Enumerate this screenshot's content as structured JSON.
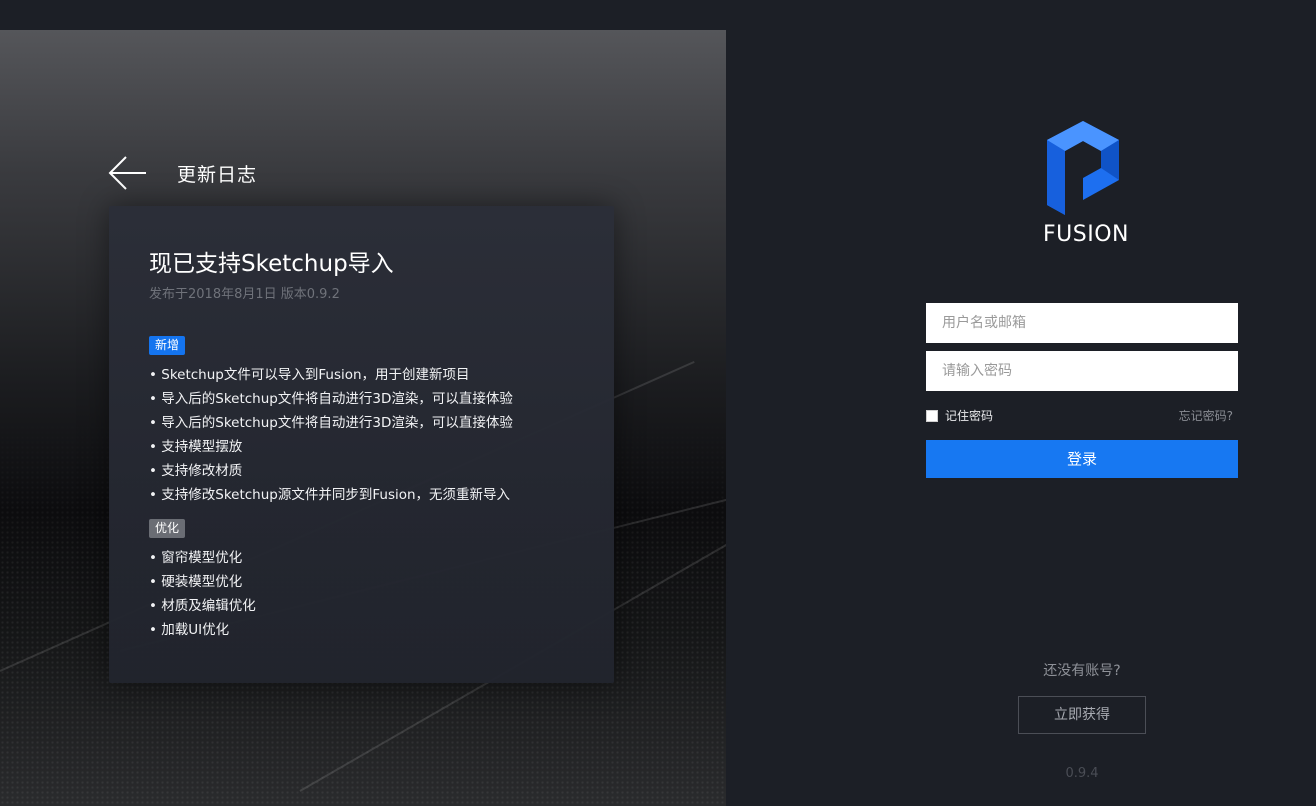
{
  "changelog": {
    "back_title": "更新日志",
    "heading": "现已支持Sketchup导入",
    "date_version": "发布于2018年8月1日 版本0.9.2",
    "new_badge": "新增",
    "new_items": [
      "• Sketchup文件可以导入到Fusion，用于创建新项目",
      "• 导入后的Sketchup文件将自动进行3D渲染，可以直接体验",
      "• 导入后的Sketchup文件将自动进行3D渲染，可以直接体验",
      "• 支持模型摆放",
      "• 支持修改材质",
      "• 支持修改Sketchup源文件并同步到Fusion，无须重新导入"
    ],
    "opt_badge": "优化",
    "opt_items": [
      "• 窗帘模型优化",
      "• 硬装模型优化",
      "• 材质及编辑优化",
      "• 加载UI优化"
    ]
  },
  "login": {
    "logo_text": "FUSION",
    "username_placeholder": "用户名或邮箱",
    "password_placeholder": "请输入密码",
    "remember_label": "记住密码",
    "forgot_label": "忘记密码?",
    "login_button": "登录",
    "no_account": "还没有账号?",
    "get_button": "立即获得",
    "version": "0.9.4"
  },
  "colors": {
    "accent": "#1778f2",
    "badge_new": "#1474ef",
    "badge_opt": "#6a6d74",
    "background": "#1c1f26",
    "logo_blue": "#1d6ff0"
  },
  "icons": {
    "back": "arrow-left-icon",
    "logo": "fusion-logo-icon"
  }
}
